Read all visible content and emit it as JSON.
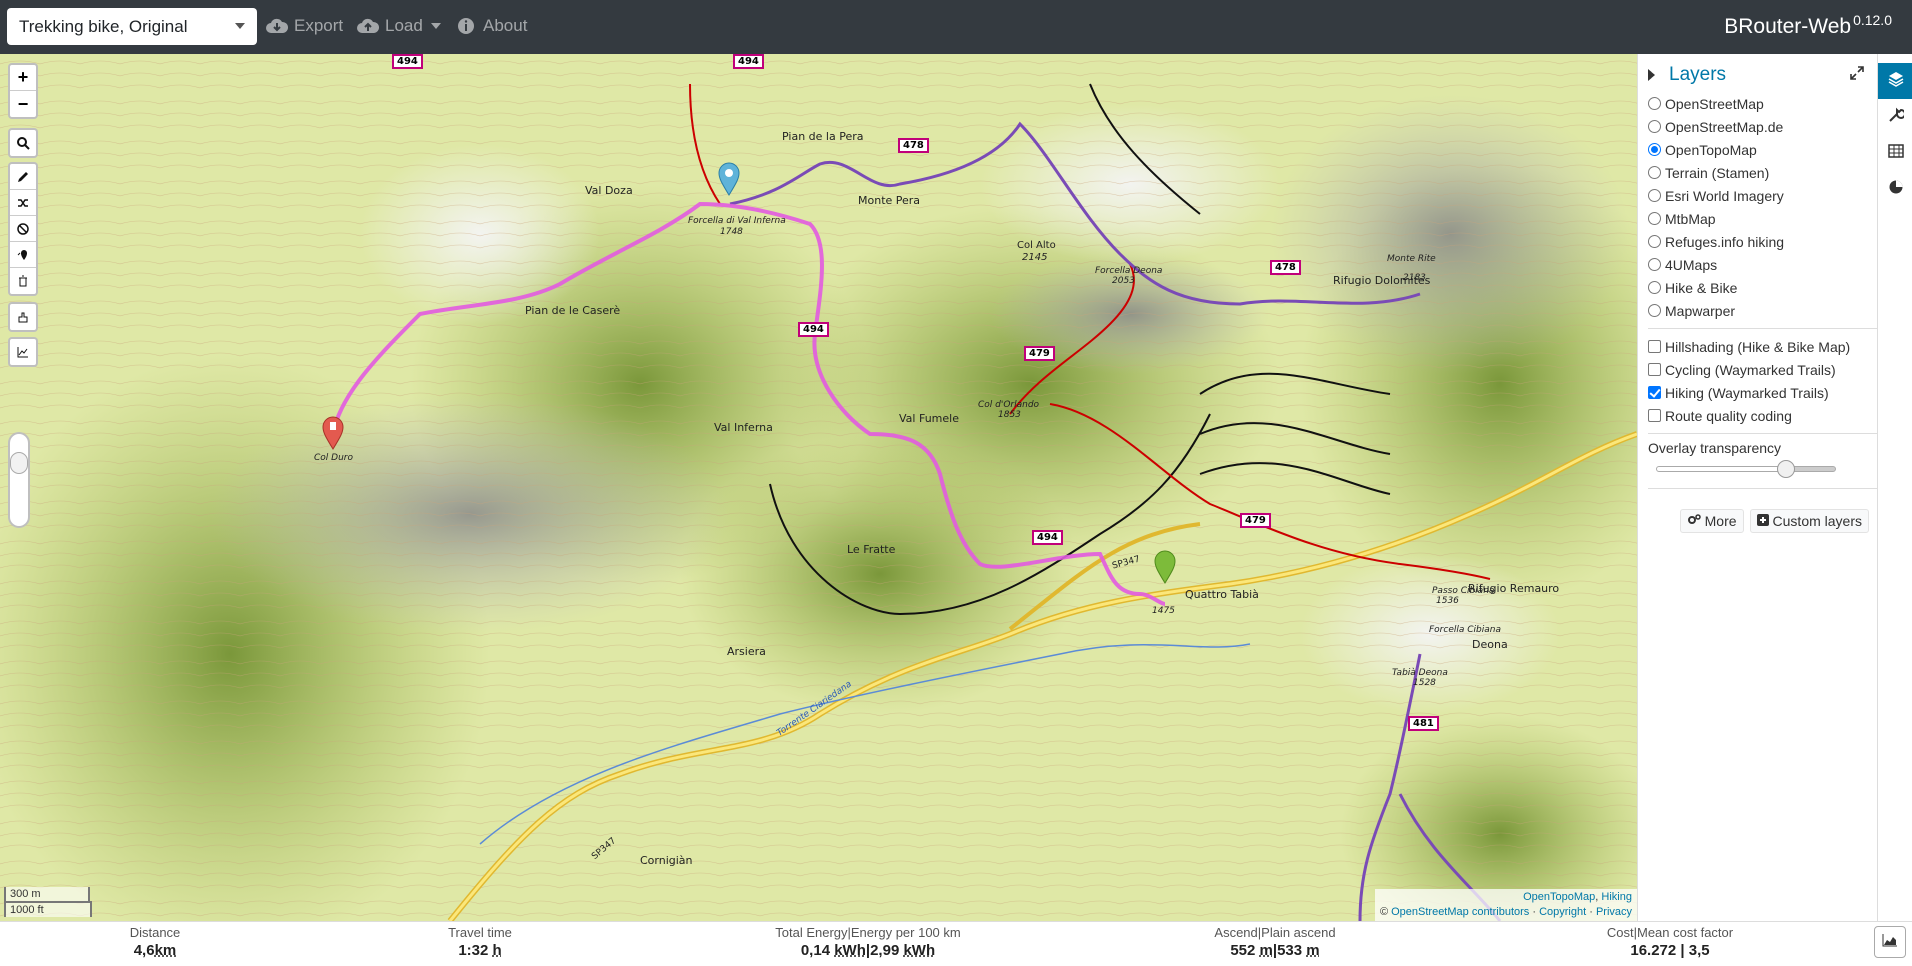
{
  "navbar": {
    "profile_select": "Trekking bike, Original",
    "export_label": "Export",
    "load_label": "Load",
    "about_label": "About",
    "brand": "BRouter-Web",
    "version": "0.12.0"
  },
  "map_controls": {
    "zoom_in": "+",
    "zoom_out": "−"
  },
  "map_labels": {
    "place": [
      "Val Doza",
      "Pian de la Pera",
      "Monte Pera",
      "Col Alto",
      "2145",
      "Forcella di Val Inferna",
      "1748",
      "Pian de le Caserè",
      "Col Duro",
      "Val Inferna",
      "Forcella Deona",
      "2053",
      "Rifugio Dolomites",
      "Monte Rite",
      "2183",
      "Col d'Orlando",
      "1853",
      "Val Fumele",
      "Le Fratte",
      "Quattro Tabià",
      "1475",
      "Rifugio Remauro",
      "Passo Cibiana",
      "1536",
      "Forcella Cibiana",
      "Deona",
      "Tabià Deona",
      "1528",
      "Arsiera",
      "Torrente Ciariedana",
      "Cornigiàn",
      "SP347",
      "SP347"
    ],
    "routes": [
      "494",
      "494",
      "478",
      "478",
      "479",
      "479",
      "494",
      "494",
      "481"
    ]
  },
  "scale": {
    "metric": "300 m",
    "imperial": "1000 ft"
  },
  "attribution": {
    "line1_a": "OpenTopoMap",
    "line1_b": "Hiking",
    "line2_prefix": "©",
    "line2_osm": "OpenStreetMap contributors",
    "copyright": "Copyright",
    "privacy": "Privacy"
  },
  "sidebar": {
    "title": "Layers",
    "base_layers": [
      {
        "label": "OpenStreetMap",
        "selected": false
      },
      {
        "label": "OpenStreetMap.de",
        "selected": false
      },
      {
        "label": "OpenTopoMap",
        "selected": true
      },
      {
        "label": "Terrain (Stamen)",
        "selected": false
      },
      {
        "label": "Esri World Imagery",
        "selected": false
      },
      {
        "label": "MtbMap",
        "selected": false
      },
      {
        "label": "Refuges.info hiking",
        "selected": false
      },
      {
        "label": "4UMaps",
        "selected": false
      },
      {
        "label": "Hike & Bike",
        "selected": false
      },
      {
        "label": "Mapwarper",
        "selected": false
      }
    ],
    "overlays": [
      {
        "label": "Hillshading (Hike & Bike Map)",
        "checked": false
      },
      {
        "label": "Cycling (Waymarked Trails)",
        "checked": false
      },
      {
        "label": "Hiking (Waymarked Trails)",
        "checked": true
      },
      {
        "label": "Route quality coding",
        "checked": false
      }
    ],
    "overlay_transparency_label": "Overlay transparency",
    "overlay_transparency_value": 0.72,
    "more_label": "More",
    "custom_layers_label": "Custom layers"
  },
  "footer": {
    "distance_label": "Distance",
    "distance_value": "4,6",
    "distance_unit": "km",
    "time_label": "Travel time",
    "time_value": "1:32",
    "time_unit": "h",
    "energy_label": "Total Energy|Energy per 100 km",
    "energy_value1": "0,14",
    "energy_unit1": "kWh",
    "energy_sep": "|",
    "energy_value2": "2,99",
    "energy_unit2": "kWh",
    "ascend_label": "Ascend|Plain ascend",
    "ascend_value1": "552",
    "ascend_unit1": "m",
    "ascend_sep": "|",
    "ascend_value2": "533",
    "ascend_unit2": "m",
    "cost_label": "Cost|Mean cost factor",
    "cost_value": "16.272 | 3,5"
  },
  "colors": {
    "navbar": "#343a40",
    "accent": "#0078a8",
    "route": "#e25be0",
    "hiking_trail": "#7a4bb6",
    "red_trail": "#cc0000",
    "road": "#f4d03f"
  }
}
